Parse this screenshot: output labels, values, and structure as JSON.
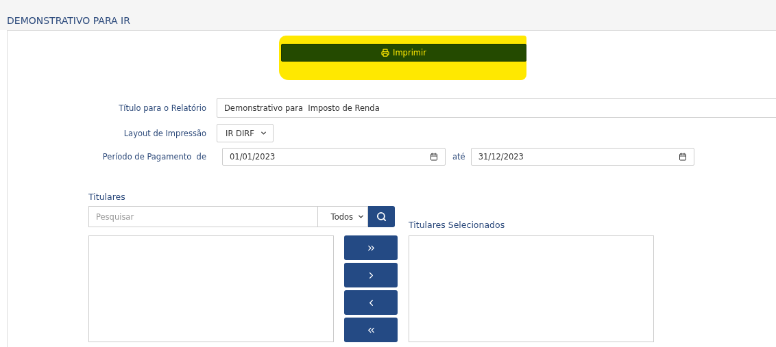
{
  "page": {
    "title": "DEMONSTRATIVO PARA IR"
  },
  "print_button": {
    "label": "Imprimir",
    "highlighted": true
  },
  "form": {
    "report_title": {
      "label": "Título para o Relatório",
      "value": "Demonstrativo para  Imposto de Renda"
    },
    "layout": {
      "label": "Layout de Impressão",
      "value": "IR DIRF"
    },
    "period": {
      "label": "Período de Pagamento  de",
      "from": "01/01/2023",
      "separator": "até",
      "to": "31/12/2023"
    }
  },
  "holders": {
    "heading": "Titulares",
    "search_placeholder": "Pesquisar",
    "filter": "Todos",
    "selected_heading": "Titulares Selecionados"
  },
  "transfer_buttons": [
    {
      "kind": "add-all"
    },
    {
      "kind": "add"
    },
    {
      "kind": "remove"
    },
    {
      "kind": "remove-all"
    }
  ]
}
